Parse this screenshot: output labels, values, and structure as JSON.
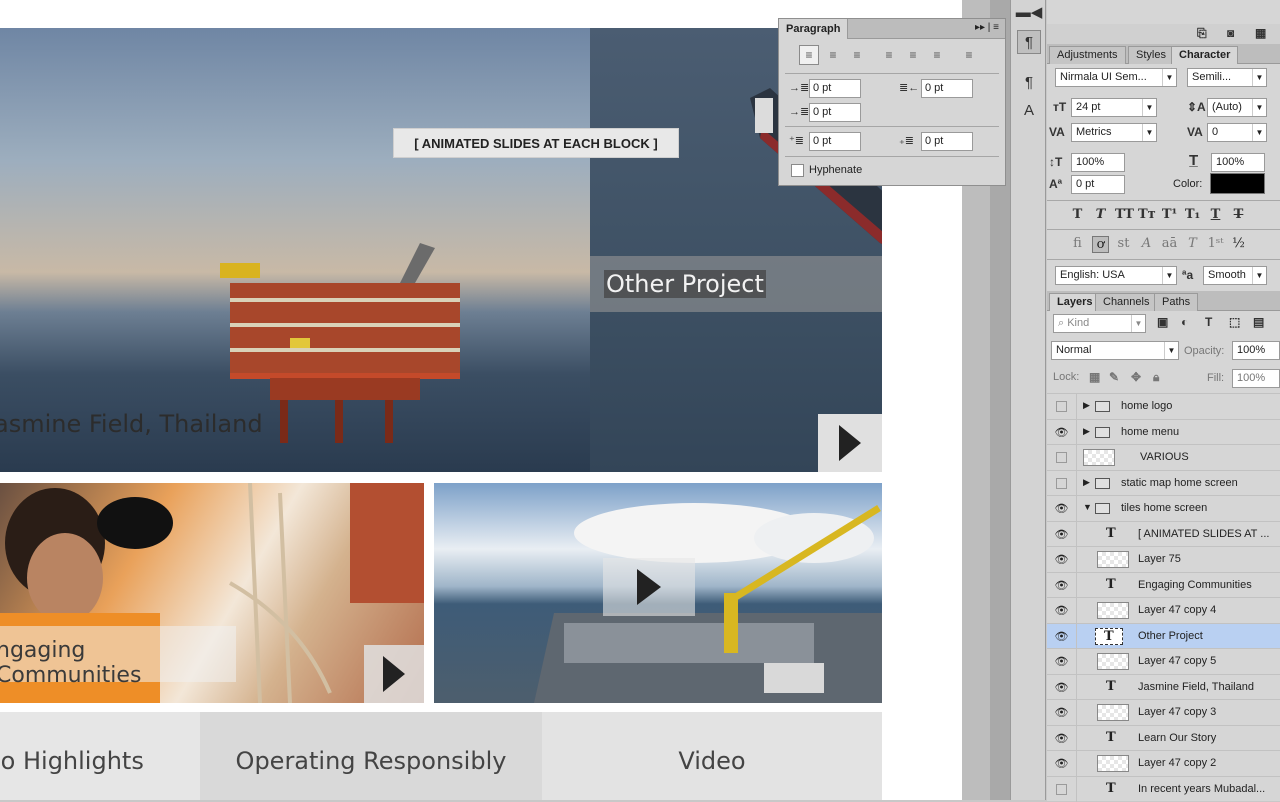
{
  "canvas": {
    "note": "[ ANIMATED SLIDES AT EACH BLOCK ]",
    "tiles": {
      "jasmine": "asmine Field, Thailand",
      "other": "Other Project",
      "engaging": "ngaging Communities"
    },
    "bottom": {
      "b1": "io Highlights",
      "b2": "Operating Responsibly",
      "b3": "Video"
    }
  },
  "paragraph_panel": {
    "title": "Paragraph",
    "indent_left": "0 pt",
    "indent_right": "0 pt",
    "indent_first": "0 pt",
    "space_before": "0 pt",
    "space_after": "0 pt",
    "hyphenate_label": "Hyphenate"
  },
  "panel_tabs": {
    "adjustments": "Adjustments",
    "styles": "Styles",
    "character": "Character"
  },
  "character": {
    "font_family": "Nirmala UI Sem...",
    "font_style": "Semili...",
    "font_size": "24 pt",
    "leading": "(Auto)",
    "kerning": "Metrics",
    "tracking": "0",
    "vertical_scale": "100%",
    "horizontal_scale": "100%",
    "baseline_shift": "0 pt",
    "color_label": "Color:",
    "color": "#000000",
    "language": "English: USA",
    "aa_symbol": "ªa",
    "antialias": "Smooth"
  },
  "layer_tabs": {
    "layers": "Layers",
    "channels": "Channels",
    "paths": "Paths"
  },
  "layers_panel": {
    "kind_placeholder": "Kind",
    "blend_mode": "Normal",
    "opacity_label": "Opacity:",
    "opacity": "100%",
    "lock_label": "Lock:",
    "fill_label": "Fill:",
    "fill": "100%",
    "items": [
      {
        "name": "home logo",
        "type": "group",
        "visible": false,
        "depth": 0,
        "expanded": false
      },
      {
        "name": "home menu",
        "type": "group",
        "visible": true,
        "depth": 0,
        "expanded": false
      },
      {
        "name": "VARIOUS",
        "type": "layer",
        "visible": false,
        "depth": 0
      },
      {
        "name": "static map home screen",
        "type": "group",
        "visible": false,
        "depth": 0,
        "expanded": false
      },
      {
        "name": "tiles home screen",
        "type": "group",
        "visible": true,
        "depth": 0,
        "expanded": true
      },
      {
        "name": "[ ANIMATED SLIDES AT ...",
        "type": "text",
        "visible": true,
        "depth": 1
      },
      {
        "name": "Layer 75",
        "type": "layer",
        "visible": true,
        "depth": 1
      },
      {
        "name": "Engaging Communities",
        "type": "text",
        "visible": true,
        "depth": 1
      },
      {
        "name": "Layer 47 copy 4",
        "type": "layer",
        "visible": true,
        "depth": 1
      },
      {
        "name": "Other Project",
        "type": "text",
        "visible": true,
        "depth": 1,
        "selected": true
      },
      {
        "name": "Layer 47 copy 5",
        "type": "layer",
        "visible": true,
        "depth": 1
      },
      {
        "name": "Jasmine Field, Thailand",
        "type": "text",
        "visible": true,
        "depth": 1
      },
      {
        "name": "Layer 47 copy 3",
        "type": "layer",
        "visible": true,
        "depth": 1
      },
      {
        "name": "Learn Our Story",
        "type": "text",
        "visible": true,
        "depth": 1
      },
      {
        "name": "Layer 47 copy 2",
        "type": "layer",
        "visible": true,
        "depth": 1
      },
      {
        "name": "In recent years Mubadal...",
        "type": "text",
        "visible": false,
        "depth": 1
      }
    ]
  }
}
